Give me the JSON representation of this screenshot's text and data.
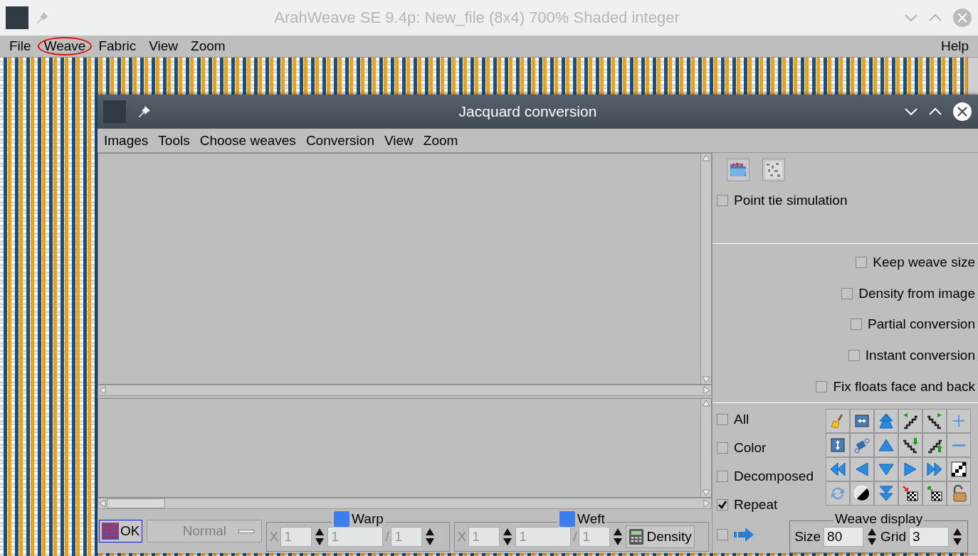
{
  "main_window": {
    "title": "ArahWeave SE 9.4p: New_file (8x4) 700% Shaded integer",
    "menu": [
      {
        "label": "File",
        "circled": false
      },
      {
        "label": "Weave",
        "circled": true
      },
      {
        "label": "Fabric",
        "circled": false
      },
      {
        "label": "View",
        "circled": false
      },
      {
        "label": "Zoom",
        "circled": false
      }
    ],
    "help": "Help"
  },
  "dialog": {
    "title": "Jacquard conversion",
    "menu": [
      "Images",
      "Tools",
      "Choose weaves",
      "Conversion",
      "View",
      "Zoom"
    ],
    "point_tie": {
      "label": "Point tie simulation",
      "checked": false
    },
    "options": [
      {
        "label": "Keep weave size",
        "checked": false
      },
      {
        "label": "Density from image",
        "checked": false
      },
      {
        "label": "Partial conversion",
        "checked": false
      },
      {
        "label": "Instant conversion",
        "checked": false
      },
      {
        "label": "Fix floats face and back",
        "checked": false
      }
    ],
    "layer_options": [
      {
        "label": "All",
        "checked": false
      },
      {
        "label": "Color",
        "checked": false
      },
      {
        "label": "Decomposed",
        "checked": false
      },
      {
        "label": "Repeat",
        "checked": true
      }
    ],
    "arrow_toggle": {
      "checked": false
    },
    "ok_button": "OK",
    "mode_select": {
      "value": "Normal",
      "disabled": true
    },
    "warp": {
      "label": "Warp",
      "x_label": "X",
      "x_value": "1",
      "start_value": "1",
      "separator": "/",
      "end_value": "1",
      "disabled": true
    },
    "weft": {
      "label": "Weft",
      "x_label": "X",
      "x_value": "1",
      "start_value": "1",
      "separator": "/",
      "end_value": "1",
      "disabled": true
    },
    "density_button": "Density",
    "weave_display": {
      "title": "Weave display",
      "size_label": "Size",
      "size_value": "80",
      "grid_label": "Grid",
      "grid_value": "3"
    }
  }
}
